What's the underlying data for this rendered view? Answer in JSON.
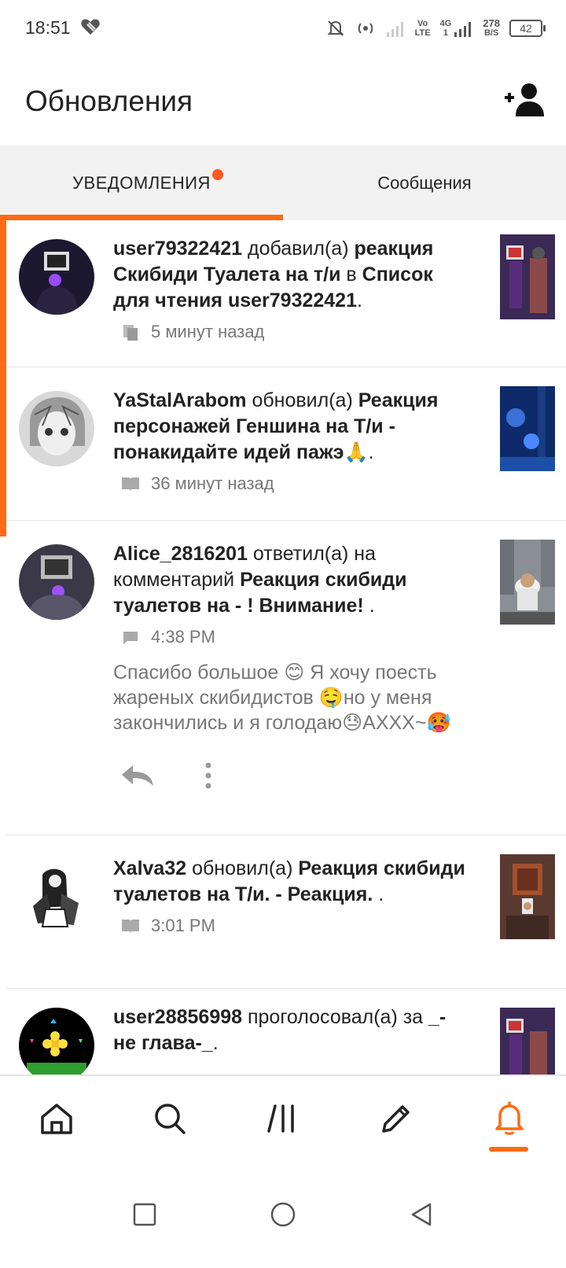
{
  "status_bar": {
    "time": "18:51",
    "network_top": "Vo",
    "network_bottom": "LTE",
    "gen_top": "4G",
    "gen_bottom": "1",
    "speed_top": "278",
    "speed_bottom": "B/S",
    "battery": "42"
  },
  "header": {
    "title": "Обновления"
  },
  "tabs": [
    {
      "label": "УВЕДОМЛЕНИЯ",
      "active": true,
      "has_dot": true
    },
    {
      "label": "Сообщения",
      "active": false,
      "has_dot": false
    }
  ],
  "notifications": [
    {
      "user": "user79322421",
      "action": " добавил(а) ",
      "target": "реакция Скибиди Туалета на т/и",
      "suffix": " в ",
      "target2": "Список для чтения user79322421",
      "end": ".",
      "meta_icon": "reading-list-icon",
      "time": "5 минут назад"
    },
    {
      "user": "YaStalArabom",
      "action": " обновил(а) ",
      "target": "Реакция персонажей Геншина на Т/и - понакидайте идей пажэ🙏",
      "end": ".",
      "meta_icon": "book-icon",
      "time": "36 минут назад"
    },
    {
      "user": "Alice_2816201",
      "action": " ответил(а) на комментарий ",
      "target": "Реакция скибиди туалетов на - ! Внимание!",
      "end": " .",
      "meta_icon": "comment-icon",
      "time": "4:38 PM",
      "comment": "Спасибо большое 😊 Я хочу поесть жареных скибидистов 🤤но у меня закончились и я голодаю😓АХХХ~🥵"
    },
    {
      "user": "Xalva32",
      "action": " обновил(а) ",
      "target": "Реакция скибиди туалетов на Т/и. - Реакция.",
      "end": " .",
      "meta_icon": "book-icon",
      "time": "3:01 PM"
    },
    {
      "user": "user28856998",
      "action": " проголосовал(а) за ",
      "target": "_-не глава-_",
      "end": "."
    }
  ],
  "bottom_nav": [
    {
      "icon": "home-icon",
      "active": false
    },
    {
      "icon": "search-icon",
      "active": false
    },
    {
      "icon": "library-icon",
      "active": false
    },
    {
      "icon": "write-icon",
      "active": false
    },
    {
      "icon": "bell-icon",
      "active": true
    }
  ],
  "colors": {
    "accent": "#ff6a13",
    "dot": "#ff5722",
    "tab_bg": "#f2f2f2"
  }
}
